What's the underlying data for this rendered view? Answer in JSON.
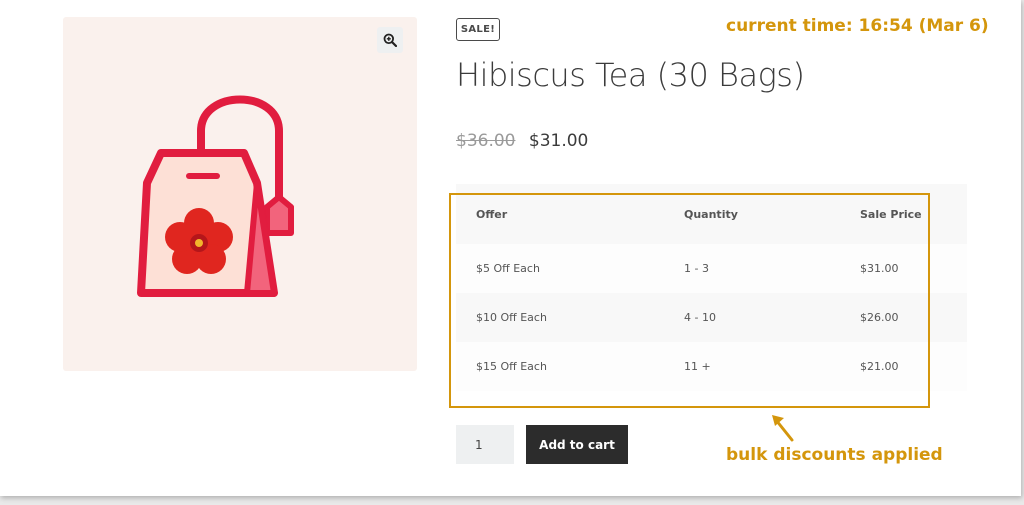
{
  "product": {
    "sale_badge": "SALE!",
    "title": "Hibiscus Tea (30 Bags)",
    "old_price": "$36.00",
    "price": "$31.00"
  },
  "discount_table": {
    "headers": [
      "Offer",
      "Quantity",
      "Sale Price"
    ],
    "rows": [
      {
        "offer": "$5 Off Each",
        "quantity": "1 - 3",
        "price": "$31.00"
      },
      {
        "offer": "$10 Off Each",
        "quantity": "4 - 10",
        "price": "$26.00"
      },
      {
        "offer": "$15 Off Each",
        "quantity": "11 +",
        "price": "$21.00"
      }
    ]
  },
  "cart": {
    "quantity_value": "1",
    "add_to_cart_label": "Add to cart"
  },
  "annotations": {
    "time_note": "current time: 16:54 (Mar 6)",
    "bulk_note": "bulk discounts applied",
    "color": "#d4960c"
  },
  "icons": {
    "zoom": "zoom-in-icon",
    "image": "tea-bag-hibiscus-icon",
    "arrow": "arrow-up-left-icon"
  },
  "colors": {
    "tea_bag_red": "#e11d3f",
    "image_background": "#faf1ed",
    "button_background": "#2c2c2c"
  }
}
